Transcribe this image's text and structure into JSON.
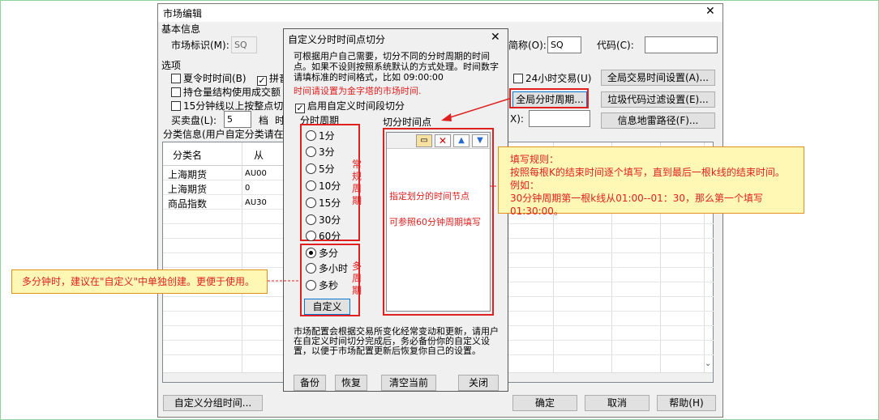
{
  "main_window": {
    "title": "市场编辑",
    "close_glyph": "✕",
    "basic_info": "基本信息",
    "market_id_label": "市场标识(M):",
    "market_id_value": "SQ",
    "name_label": "简称(O):",
    "name_value": "SQ",
    "code_label": "代码(C):",
    "code_value": "",
    "options_label": "选项",
    "opt_summer": "夏令时时间(B)",
    "opt_pin": "拼音",
    "opt_position": "持仓量结构使用成交额",
    "opt_15min": "15分钟线以上按整点切分",
    "opt_24h": "24小时交易(U)",
    "buy_sell_label": "买卖盘(L):",
    "buy_sell_value": "5",
    "buy_sell_unit": "档",
    "buy_sell_time": "时",
    "x_label": "X):",
    "btn_global_trade_time": "全局交易时间设置(A)...",
    "btn_global_period": "全局分时周期...",
    "btn_junk_filter": "垃圾代码过滤设置(E)...",
    "btn_info_path": "信息地雷路径(F)...",
    "category_header": "分类信息(用户自定分类请在",
    "table": {
      "columns": [
        "分类名",
        "从"
      ],
      "rows": [
        [
          "上海期货",
          "AU00"
        ],
        [
          "上海期货",
          "0"
        ],
        [
          "商品指数",
          "AU30"
        ]
      ]
    },
    "btn_custom_group_time": "自定义分组时间...",
    "btn_ok": "确定",
    "btn_cancel": "取消",
    "btn_help": "帮助(H)"
  },
  "dialog": {
    "title": "自定义分时时间点切分",
    "close_glyph": "✕",
    "desc": "可根据用户自己需要，切分不同的分时周期的时间点。如果不设则按照系统默认的方式处理。时间数字请填标准的时间格式，比如 09:00:00",
    "desc_red": "时间请设置为金字塔的市场时间.",
    "enable_label": "启用自定义时间段切分",
    "period_label": "分时周期",
    "periods": [
      "1分",
      "3分",
      "5分",
      "10分",
      "15分",
      "30分",
      "60分"
    ],
    "regular_label": "常规周期",
    "multi": [
      "多分",
      "多小时",
      "多秒"
    ],
    "multi_label": "多周期",
    "btn_custom": "自定义",
    "cut_points_label": "切分时间点",
    "hint1": "指定划分的时间节点",
    "hint2": "可参照60分钟周期填写",
    "bottom_desc": "市场配置会根据交易所变化经常变动和更新，请用户在自定义时间切分完成后，务必备份你的自定义设置，以便于市场配置更新后恢复你自己的设置。",
    "btn_backup": "备份",
    "btn_restore": "恢复",
    "btn_clear": "清空当前",
    "btn_close": "关闭"
  },
  "callout_left": "多分钟时，建议在\"自定义\"中单独创建。更便于使用。",
  "callout_right": {
    "line1": "填写规则：",
    "line2": "按照每根K的结束时间逐个填写，直到最后一根k线的结束时间。",
    "line3": "例如：",
    "line4": "30分钟周期第一根k线从01:00--01：30，那么第一个填写01:30:00。"
  },
  "colors": {
    "annotation_red": "#e02020",
    "callout_bg": "#fff8b4"
  }
}
